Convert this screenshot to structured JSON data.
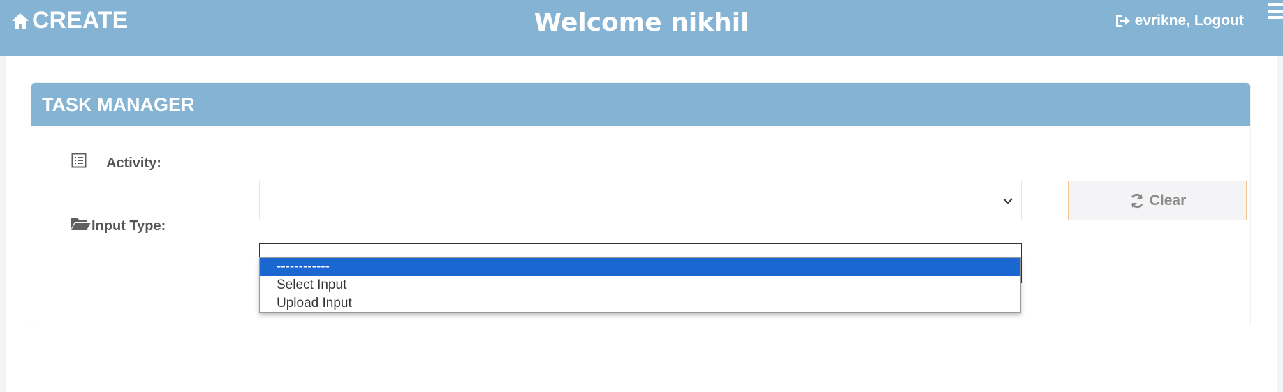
{
  "header": {
    "brand_label": "CREATE",
    "welcome_text": "Welcome nikhil",
    "user_link": "evrikne, Logout"
  },
  "panel": {
    "title": "TASK MANAGER"
  },
  "form": {
    "activity_label": "Activity:",
    "activity_value": "",
    "input_type_label": "Input Type:",
    "input_type_value": "------------",
    "clear_label": "Clear"
  },
  "dropdown": {
    "options": [
      "------------",
      "Select Input",
      "Upload Input"
    ],
    "selected_index": 0
  },
  "icons": {
    "brand": "home-icon",
    "logout": "sign-out-icon",
    "menu": "hamburger-menu-icon",
    "activity": "list-alt-icon",
    "input_type": "folder-open-icon",
    "clear": "refresh-icon",
    "select": "chevron-down-icon"
  },
  "colors": {
    "header_bg": "#84b3d3",
    "highlight": "#1a67d2",
    "clear_border": "#f5c48f"
  }
}
